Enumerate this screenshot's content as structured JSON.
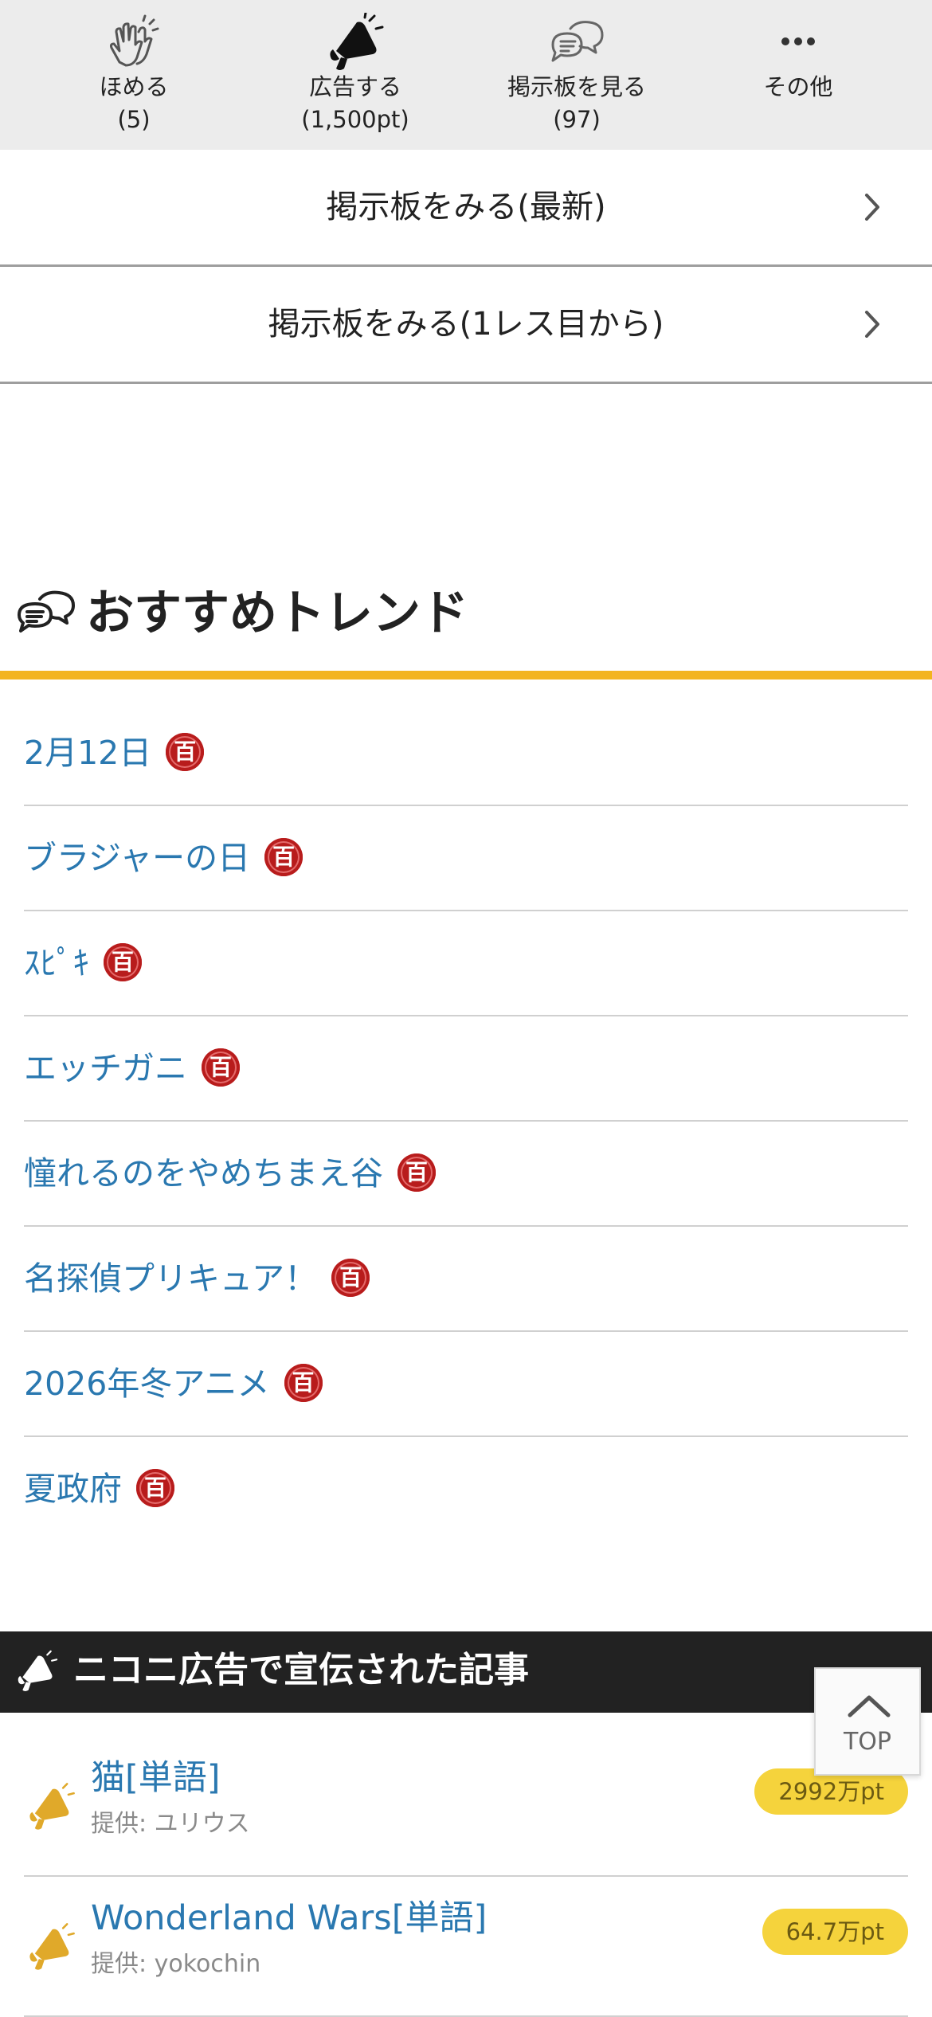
{
  "action_bar": {
    "items": [
      {
        "label": "ほめる",
        "count": "(5)",
        "icon": "clapping-hands-icon"
      },
      {
        "label": "広告する",
        "count": "(1,500pt)",
        "icon": "megaphone-icon"
      },
      {
        "label": "掲示板を見る",
        "count": "(97)",
        "icon": "speech-bubbles-icon"
      },
      {
        "label": "その他",
        "count": "",
        "icon": "more-dots-icon"
      }
    ]
  },
  "board_links": {
    "latest": "掲示板をみる(最新)",
    "from_first": "掲示板をみる(1レス目から)"
  },
  "trend": {
    "title": "おすすめトレンド",
    "badge": "百",
    "items": [
      "2月12日",
      "ブラジャーの日",
      "ｽﾋﾟｷ",
      "エッチガニ",
      "憧れるのをやめちまえ谷",
      "名探偵プリキュア！",
      "2026年冬アニメ",
      "夏政府"
    ]
  },
  "ads": {
    "title": "ニコニ広告で宣伝された記事",
    "items": [
      {
        "name": "猫[単語]",
        "by": "提供: ユリウス",
        "points": "2992万pt"
      },
      {
        "name": "Wonderland Wars[単語]",
        "by": "提供: yokochin",
        "points": "64.7万pt"
      }
    ]
  },
  "top_button": {
    "label": "TOP"
  },
  "colors": {
    "accent_orange": "#f3b41f",
    "link_blue": "#2a78b0",
    "badge_red": "#b81c1c",
    "points_yellow": "#f5d33c",
    "dark_header": "#222222"
  }
}
